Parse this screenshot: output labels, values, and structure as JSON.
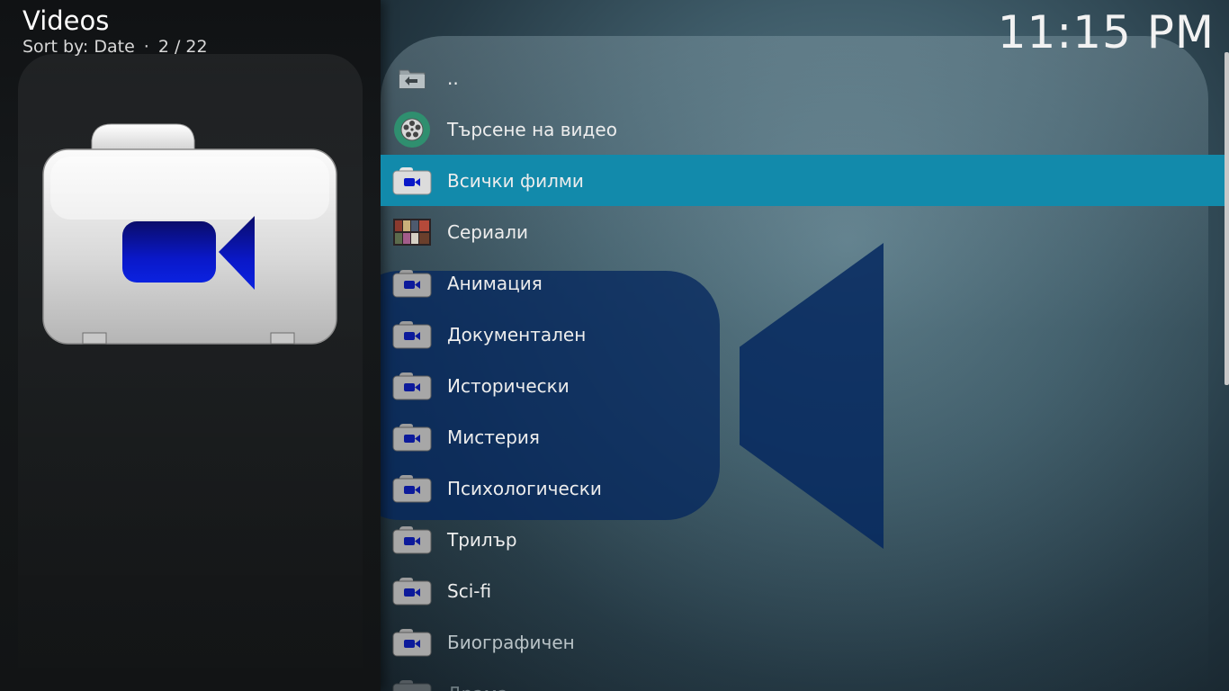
{
  "header": {
    "title": "Videos",
    "sort_label": "Sort by: Date",
    "separator": "·",
    "position": "2 / 22"
  },
  "clock": "11:15 PM",
  "list": {
    "items": [
      {
        "label": "..",
        "icon": "folder-back-icon"
      },
      {
        "label": "Търсене на видео",
        "icon": "film-reel-icon"
      },
      {
        "label": "Всички филми",
        "icon": "video-folder-icon"
      },
      {
        "label": "Сериали",
        "icon": "tv-shows-thumbnail-icon"
      },
      {
        "label": "Анимация",
        "icon": "video-folder-icon"
      },
      {
        "label": "Документален",
        "icon": "video-folder-icon"
      },
      {
        "label": "Исторически",
        "icon": "video-folder-icon"
      },
      {
        "label": "Мистерия",
        "icon": "video-folder-icon"
      },
      {
        "label": "Психологически",
        "icon": "video-folder-icon"
      },
      {
        "label": "Трилър",
        "icon": "video-folder-icon"
      },
      {
        "label": "Sci-fi",
        "icon": "video-folder-icon"
      },
      {
        "label": "Биографичен",
        "icon": "video-folder-icon"
      },
      {
        "label": "Драма",
        "icon": "video-folder-icon"
      }
    ],
    "focused_index": 2
  },
  "colors": {
    "focus": "#128aab",
    "camera_blue": "#0a1fd6"
  }
}
